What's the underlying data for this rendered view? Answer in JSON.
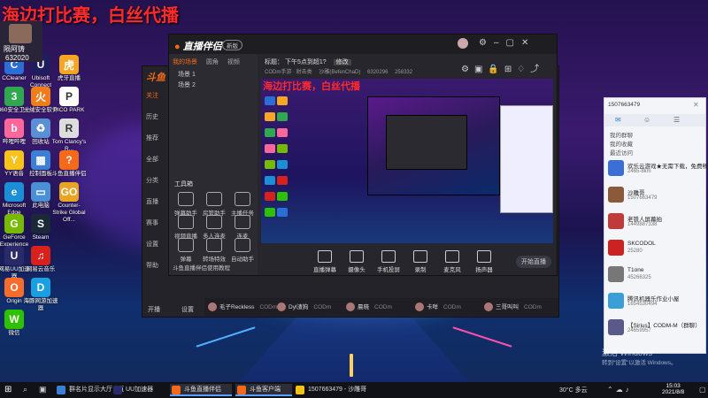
{
  "stream": {
    "title": "海边打比赛，白丝代播",
    "badge_name": "陨阿铸",
    "badge_id": "632020"
  },
  "desktop_icons": [
    {
      "label": "CCleaner",
      "color": "#2a6fd6",
      "glyph": "C"
    },
    {
      "label": "Ubisoft Connect",
      "color": "#1e1e5e",
      "glyph": "U"
    },
    {
      "label": "虎牙直播",
      "color": "#f5a623",
      "glyph": "虎"
    },
    {
      "label": "360安全卫士",
      "color": "#2fa84f",
      "glyph": "3"
    },
    {
      "label": "火绒安全软件",
      "color": "#f07d1a",
      "glyph": "火"
    },
    {
      "label": "PICO PARK",
      "color": "#ffffff",
      "glyph": "P"
    },
    {
      "label": "哔哩哔哩",
      "color": "#ff6699",
      "glyph": "b"
    },
    {
      "label": "回收站",
      "color": "#5a8fd6",
      "glyph": "♻"
    },
    {
      "label": "Tom Clancy's R...",
      "color": "#ddd",
      "glyph": "R"
    },
    {
      "label": "YY语音",
      "color": "#f7c21a",
      "glyph": "Y"
    },
    {
      "label": "控制面板",
      "color": "#3c7fd6",
      "glyph": "▦"
    },
    {
      "label": "斗鱼直播伴侣",
      "color": "#f56a1a",
      "glyph": "?"
    },
    {
      "label": "Microsoft Edge",
      "color": "#1a8fd6",
      "glyph": "e"
    },
    {
      "label": "此电脑",
      "color": "#4a90d6",
      "glyph": "▭"
    },
    {
      "label": "Counter-Strike Global Off...",
      "color": "#e9a423",
      "glyph": "GO"
    },
    {
      "label": "GeForce Experience",
      "color": "#76b900",
      "glyph": "G"
    },
    {
      "label": "网易UU加速器",
      "color": "#2a2a6a",
      "glyph": "U"
    },
    {
      "label": "Steam",
      "color": "#1b2838",
      "glyph": "S"
    },
    {
      "label": "Origin",
      "color": "#f56c2d",
      "glyph": "O"
    },
    {
      "label": "网易云音乐",
      "color": "#d8201c",
      "glyph": "♫"
    },
    {
      "label": "微信",
      "color": "#2dc100",
      "glyph": "W"
    },
    {
      "label": "海豚网游加速器",
      "color": "#1a9fe0",
      "glyph": "D"
    }
  ],
  "main_window": {
    "app_name": "直播伴侣",
    "header_badge": "新版",
    "room_label": "标题",
    "room_title": "下午5点到超1?",
    "room_edit": "修改",
    "room_meta": "CODm手游 · 射击类",
    "room_user": "沙雕(BefenChaD)",
    "room_id": "6320296",
    "room_count": "258332",
    "side_tabs": [
      "我的场景",
      "圆角",
      "视频"
    ],
    "scenes": [
      "场景 1",
      "场景 2"
    ],
    "toolbox_label": "工具箱",
    "tools": [
      "弹幕助手",
      "房管助手",
      "主播任务",
      "视频直播",
      "多人连麦",
      "连麦",
      "弹幕",
      "转场特效",
      "自动助手"
    ],
    "bottom_promo": "斗鱼直播伴侣使用教程",
    "footer_left": [
      "开播",
      "设置"
    ],
    "controls": [
      "直播弹幕",
      "摄像头",
      "手机投屏",
      "录制",
      "麦克风",
      "扬声器"
    ],
    "go_live": "开始直播",
    "left_nav": [
      "关注",
      "历史",
      "推荐",
      "全部",
      "分类",
      "直播",
      "赛事",
      "设置",
      "帮助"
    ]
  },
  "streamer_row": [
    {
      "name": "毛子Reckless",
      "tag": "CODm"
    },
    {
      "name": "Dyl渣狗",
      "tag": "CODm"
    },
    {
      "name": "晨晓",
      "tag": "CODm"
    },
    {
      "name": "卡咩",
      "tag": "CODm"
    },
    {
      "name": "三哥叫叫",
      "tag": "CODm"
    }
  ],
  "chat_window": {
    "search_value": "1507663479",
    "tabs": [
      "我的群",
      "好友",
      "最近"
    ],
    "sections": [
      "我的群聊",
      "我的收藏",
      "最近访问"
    ],
    "contacts": [
      {
        "name": "欢乐云游戏★无需下载，免费畅玩",
        "sub": "2465-8km",
        "color": "#3a6fd6"
      },
      {
        "name": "沙雕哥",
        "sub": "1507663479",
        "color": "#8a5a3a"
      },
      {
        "name": "老铁人屏幕拍",
        "sub": "1449887338",
        "color": "#c03a3a"
      },
      {
        "name": "SKCODOL",
        "sub": "25280",
        "color": "#cc2222"
      },
      {
        "name": "T1one",
        "sub": "45266325",
        "color": "#777"
      },
      {
        "name": "腾讯机器乐作业小屋",
        "sub": "1654530494",
        "color": "#3a9fd6"
      },
      {
        "name": "【Sirius】CODM-M（群聊）",
        "sub": "24659957",
        "color": "#5a5a8a"
      }
    ]
  },
  "activation": {
    "line1": "激活 Windows",
    "line2": "转到“设置”以激活 Windows。"
  },
  "taskbar": {
    "apps": [
      {
        "label": "群名片显示大厅 - 直播...",
        "color": "#3c7fd6"
      },
      {
        "label": "UU加速器",
        "color": "#2a2a6a"
      },
      {
        "label": "斗鱼直播伴侣",
        "color": "#f56a1a",
        "active": true
      },
      {
        "label": "斗鱼客户端",
        "color": "#f56a1a",
        "active": true
      },
      {
        "label": "1507663479 - 沙雕哥",
        "color": "#f5c21a"
      }
    ],
    "weather": "30°C 多云",
    "time": "15:03",
    "date": "2021/8/8"
  },
  "colors": {
    "brand": "#f56a1a",
    "stream_red": "#ff2a2a",
    "live_pill": "#3a3a44"
  }
}
